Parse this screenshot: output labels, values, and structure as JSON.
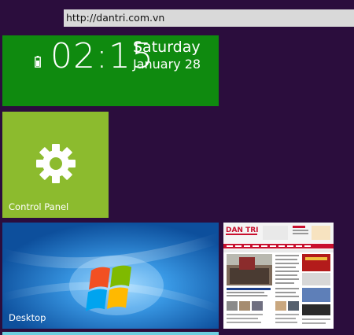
{
  "address_bar": {
    "url": "http://dantri.com.vn"
  },
  "clock_tile": {
    "time": "02:15",
    "day": "Saturday",
    "date": "January 28",
    "battery_icon": "battery-icon",
    "color": "#0f8a0f"
  },
  "control_panel_tile": {
    "label": "Control Panel",
    "icon": "gear-icon",
    "color": "#8cbb2e"
  },
  "desktop_tile": {
    "label": "Desktop",
    "icon": "windows-logo",
    "color": "#1b76c9"
  },
  "website_tile": {
    "logo_text": "DAN TRI",
    "description": "thumbnail of news website"
  },
  "background_color": "#2b0d3d"
}
